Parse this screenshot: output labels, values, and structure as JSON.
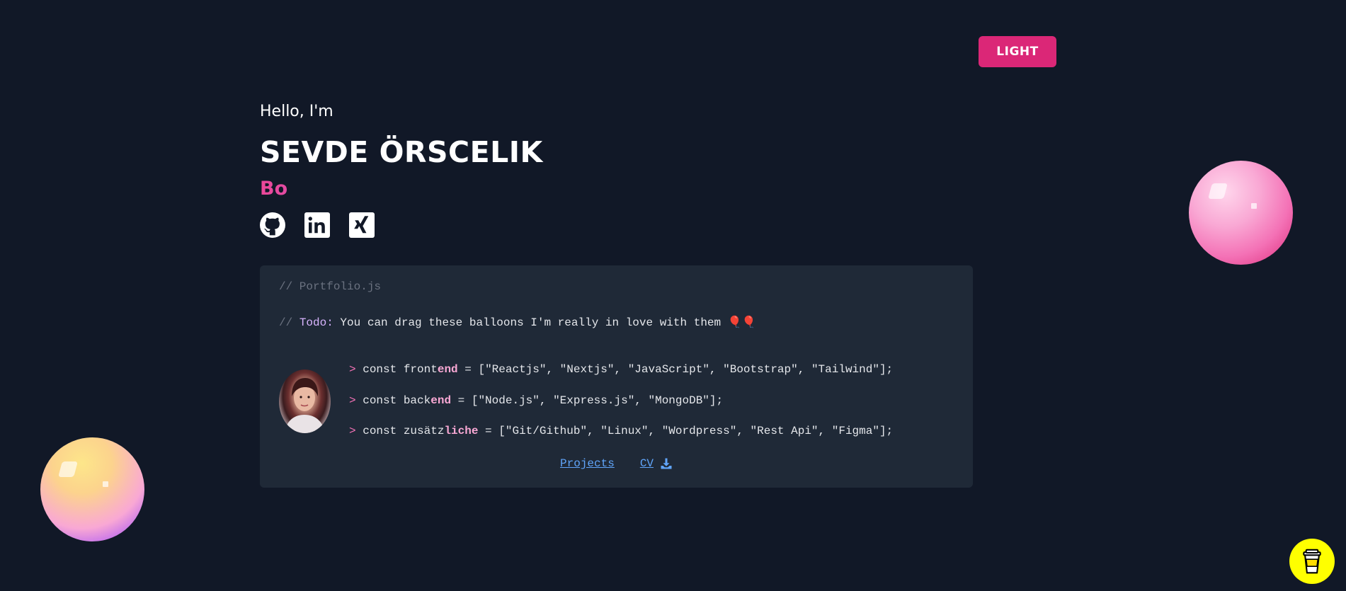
{
  "header": {
    "theme_toggle_label": "LIGHT"
  },
  "intro": {
    "greeting": "Hello, I'm",
    "name": "SEVDE ÖRSCELIK",
    "typed_role": "Bo"
  },
  "socials": [
    {
      "icon": "github-icon"
    },
    {
      "icon": "linkedin-icon"
    },
    {
      "icon": "xing-icon"
    }
  ],
  "code_card": {
    "file_comment": "// Portfolio.js",
    "todo": {
      "slashes": "// ",
      "tag": "Todo:",
      "text": " You can drag these balloons I'm really in love with them ",
      "emoji": "🎈🎈"
    },
    "lines": [
      {
        "prompt": ">",
        "const": " const ",
        "name_plain": "front",
        "name_bold": "end",
        "rest": " = [\"Reactjs\", \"Nextjs\", \"JavaScript\", \"Bootstrap\", \"Tailwind\"];"
      },
      {
        "prompt": ">",
        "const": " const ",
        "name_plain": "back",
        "name_bold": "end",
        "rest": " = [\"Node.js\", \"Express.js\", \"MongoDB\"];"
      },
      {
        "prompt": ">",
        "const": " const ",
        "name_plain": "zusätz",
        "name_bold": "liche",
        "rest": " = [\"Git/Github\", \"Linux\", \"Wordpress\", \"Rest Api\", \"Figma\"];"
      }
    ],
    "links": {
      "projects": "Projects",
      "cv": "CV"
    }
  },
  "colors": {
    "background": "#111827",
    "card": "#1f2937",
    "accent": "#db2777",
    "link": "#60a5fa",
    "coffee": "#ffff00"
  }
}
